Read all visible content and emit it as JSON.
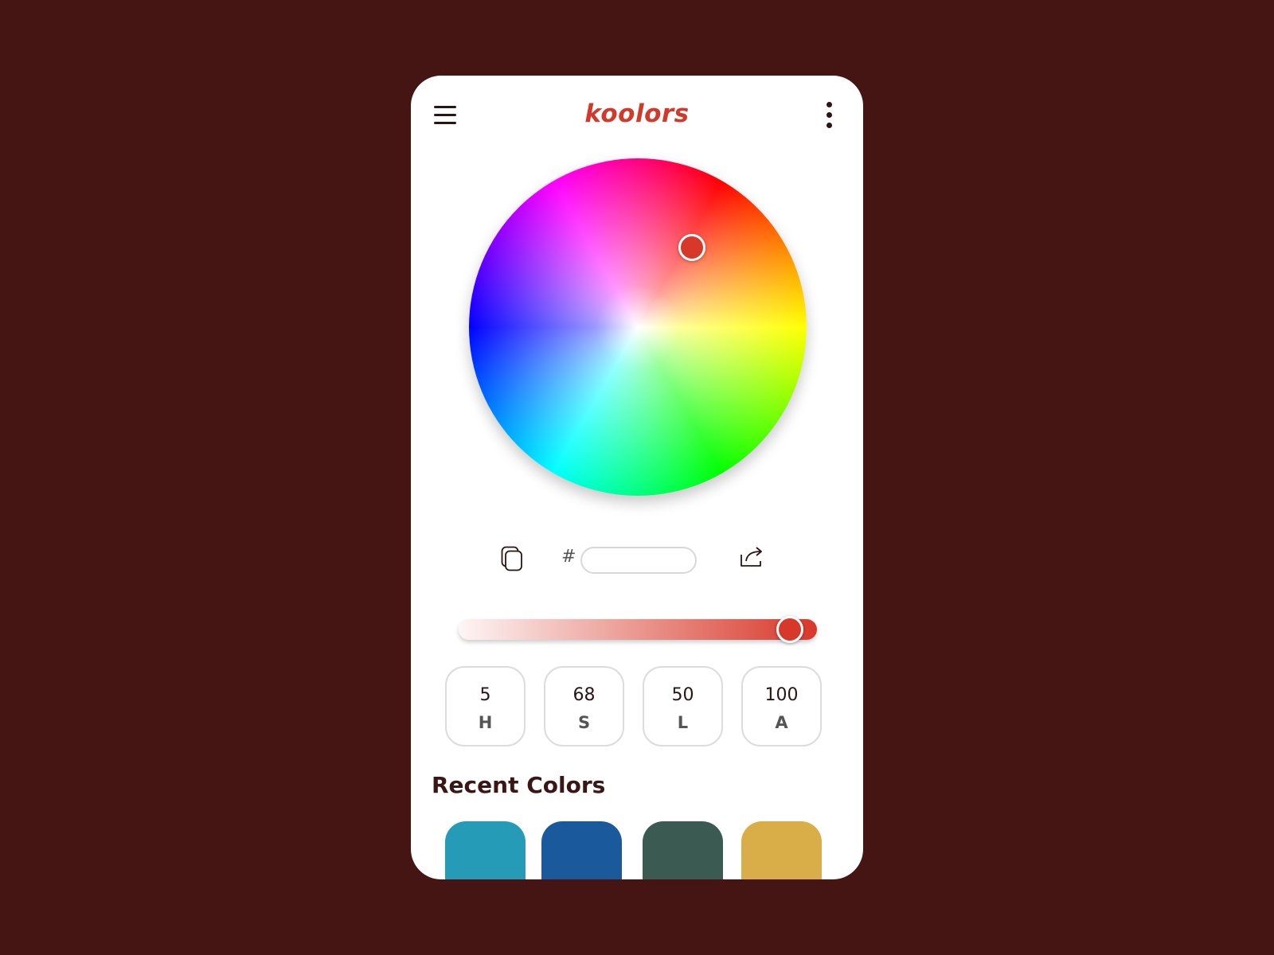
{
  "app": {
    "title": "koolors",
    "accent_color": "#cf3a2b",
    "background_color": "#451513"
  },
  "header": {
    "menu_icon": "hamburger-menu-icon",
    "more_icon": "vertical-dots-icon"
  },
  "picker": {
    "selected_color": "#d8382a",
    "hex": {
      "prefix": "#",
      "value": "",
      "placeholder": ""
    },
    "copy_icon": "copy-icon",
    "share_icon": "share-icon",
    "alpha_percent": 100
  },
  "hsla": [
    {
      "value": "5",
      "label": "H"
    },
    {
      "value": "68",
      "label": "S"
    },
    {
      "value": "50",
      "label": "L"
    },
    {
      "value": "100",
      "label": "A"
    }
  ],
  "recent": {
    "title": "Recent Colors",
    "colors": [
      "#269bb8",
      "#1a5a9c",
      "#3a5a52",
      "#d9ae48"
    ]
  }
}
